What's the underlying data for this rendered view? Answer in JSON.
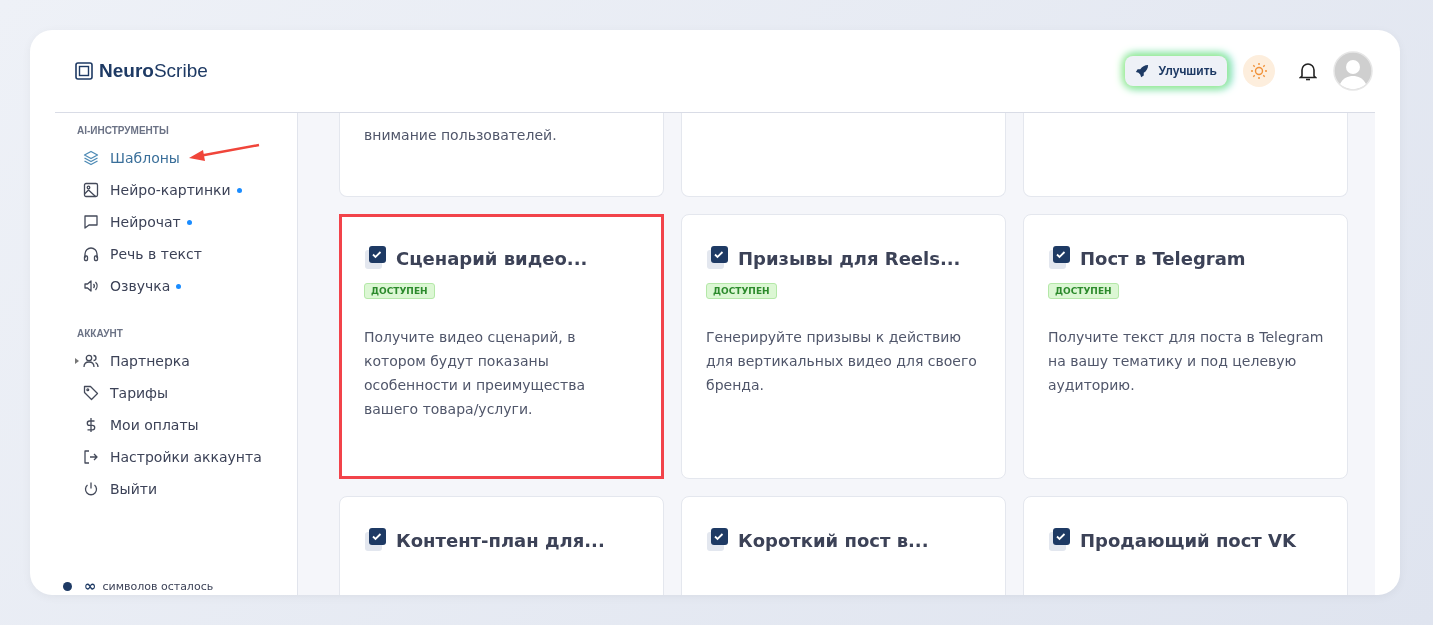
{
  "logo": {
    "bold": "Neuro",
    "light": "Scribe"
  },
  "header": {
    "upgrade_label": "Улучшить"
  },
  "sidebar": {
    "sections": [
      {
        "title": "AI-ИНСТРУМЕНТЫ",
        "items": [
          {
            "label": "Шаблоны",
            "selected": true,
            "dot": false,
            "marked": true,
            "expandable": false
          },
          {
            "label": "Нейро-картинки",
            "selected": false,
            "dot": true,
            "marked": false,
            "expandable": false
          },
          {
            "label": "Нейрочат",
            "selected": false,
            "dot": true,
            "marked": false,
            "expandable": false
          },
          {
            "label": "Речь в текст",
            "selected": false,
            "dot": false,
            "marked": false,
            "expandable": false
          },
          {
            "label": "Озвучка",
            "selected": false,
            "dot": true,
            "marked": false,
            "expandable": false
          }
        ]
      },
      {
        "title": "АККАУНТ",
        "items": [
          {
            "label": "Партнерка",
            "selected": false,
            "dot": false,
            "marked": false,
            "expandable": true
          },
          {
            "label": "Тарифы",
            "selected": false,
            "dot": false,
            "marked": false,
            "expandable": false
          },
          {
            "label": "Мои оплаты",
            "selected": false,
            "dot": false,
            "marked": false,
            "expandable": false
          },
          {
            "label": "Настройки аккаунта",
            "selected": false,
            "dot": false,
            "marked": false,
            "expandable": false
          },
          {
            "label": "Выйти",
            "selected": false,
            "dot": false,
            "marked": false,
            "expandable": false
          }
        ]
      }
    ],
    "footer": {
      "amount": "∞",
      "text": "символов осталось"
    }
  },
  "cards": [
    {
      "description": "внимание пользователей.",
      "highlighted": false
    },
    {
      "highlighted": false
    },
    {
      "highlighted": false
    },
    {
      "title": "Сценарий видео...",
      "badge": "ДОСТУПЕН",
      "description": "Получите видео сценарий, в котором будут показаны особенности и преимущества вашего товара/услуги.",
      "highlighted": true
    },
    {
      "title": "Призывы для Reels...",
      "badge": "ДОСТУПЕН",
      "description": "Генерируйте призывы к действию для вертикальных видео для своего бренда.",
      "highlighted": false
    },
    {
      "title": "Пост в Telegram",
      "badge": "ДОСТУПЕН",
      "description": "Получите текст для поста в Telegram на вашу тематику и под целевую аудиторию.",
      "highlighted": false
    },
    {
      "title": "Контент-план для...",
      "highlighted": false
    },
    {
      "title": "Короткий пост в...",
      "highlighted": false
    },
    {
      "title": "Продающий пост VK",
      "highlighted": false
    }
  ]
}
